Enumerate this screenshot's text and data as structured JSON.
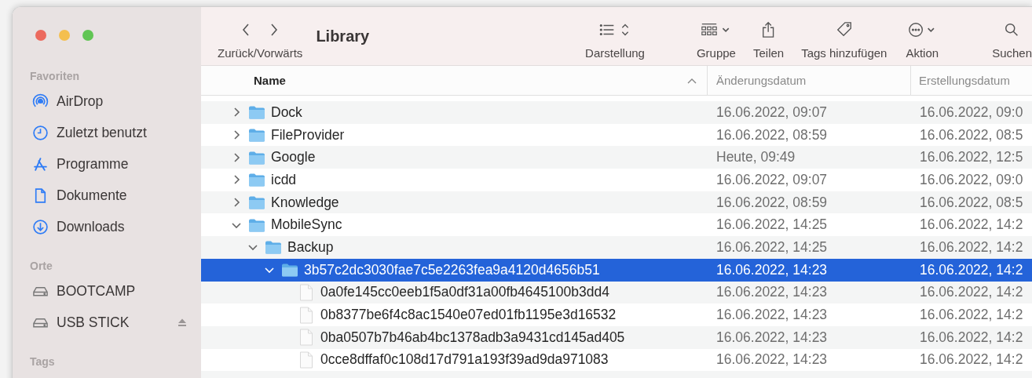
{
  "window": {
    "title": "Library"
  },
  "toolbar": {
    "nav_label": "Zurück/Vorwärts",
    "items": [
      {
        "kind": "view",
        "label": "Darstellung"
      },
      {
        "kind": "group",
        "label": "Gruppe"
      },
      {
        "kind": "share",
        "label": "Teilen"
      },
      {
        "kind": "tags",
        "label": "Tags hinzufügen"
      },
      {
        "kind": "action",
        "label": "Aktion"
      },
      {
        "kind": "search",
        "label": "Suchen"
      }
    ]
  },
  "sidebar": {
    "sections": [
      {
        "title": "Favoriten",
        "items": [
          {
            "kind": "airdrop",
            "label": "AirDrop",
            "selected": false
          },
          {
            "kind": "recent",
            "label": "Zuletzt benutzt",
            "selected": false
          },
          {
            "kind": "apps",
            "label": "Programme",
            "selected": false
          },
          {
            "kind": "documents",
            "label": "Dokumente",
            "selected": false
          },
          {
            "kind": "downloads",
            "label": "Downloads",
            "selected": false
          }
        ]
      },
      {
        "title": "Orte",
        "items": [
          {
            "kind": "drive",
            "label": "BOOTCAMP",
            "selected": false,
            "ejectable": false
          },
          {
            "kind": "drive",
            "label": "USB STICK",
            "selected": false,
            "ejectable": true
          }
        ]
      },
      {
        "title": "Tags"
      }
    ]
  },
  "table": {
    "columns": [
      {
        "label": "Name",
        "sorted": true
      },
      {
        "label": "Änderungsdatum",
        "sorted": false
      },
      {
        "label": "Erstellungsdatum",
        "sorted": false
      }
    ],
    "rows": [
      {
        "kind": "folder",
        "name": "Dock",
        "modified": "16.06.2022, 09:07",
        "created": "16.06.2022, 09:0",
        "expanded": false,
        "selected": false
      },
      {
        "kind": "folder",
        "name": "FileProvider",
        "modified": "16.06.2022, 08:59",
        "created": "16.06.2022, 08:5",
        "expanded": false,
        "selected": false
      },
      {
        "kind": "folder",
        "name": "Google",
        "modified": "Heute, 09:49",
        "created": "16.06.2022, 12:5",
        "expanded": false,
        "selected": false
      },
      {
        "kind": "folder",
        "name": "icdd",
        "modified": "16.06.2022, 09:07",
        "created": "16.06.2022, 09:0",
        "expanded": false,
        "selected": false
      },
      {
        "kind": "folder",
        "name": "Knowledge",
        "modified": "16.06.2022, 08:59",
        "created": "16.06.2022, 08:5",
        "expanded": false,
        "selected": false
      },
      {
        "kind": "folder",
        "name": "MobileSync",
        "modified": "16.06.2022, 14:25",
        "created": "16.06.2022, 14:2",
        "expanded": true,
        "selected": false,
        "children": [
          {
            "kind": "folder",
            "name": "Backup",
            "modified": "16.06.2022, 14:25",
            "created": "16.06.2022, 14:2",
            "expanded": true,
            "selected": false,
            "children": [
              {
                "kind": "folder",
                "name": "3b57c2dc3030fae7c5e2263fea9a4120d4656b51",
                "modified": "16.06.2022, 14:23",
                "created": "16.06.2022, 14:2",
                "expanded": true,
                "selected": true,
                "children": [
                  {
                    "kind": "file",
                    "name": "0a0fe145cc0eeb1f5a0df31a00fb4645100b3dd4",
                    "modified": "16.06.2022, 14:23",
                    "created": "16.06.2022, 14:2",
                    "selected": false
                  },
                  {
                    "kind": "file",
                    "name": "0b8377be6f4c8ac1540e07ed01fb1195e3d16532",
                    "modified": "16.06.2022, 14:23",
                    "created": "16.06.2022, 14:2",
                    "selected": false
                  },
                  {
                    "kind": "file",
                    "name": "0ba0507b7b46ab4bc1378adb3a9431cd145ad405",
                    "modified": "16.06.2022, 14:23",
                    "created": "16.06.2022, 14:2",
                    "selected": false
                  },
                  {
                    "kind": "file",
                    "name": "0cce8dffaf0c108d17d791a193f39ad9da971083",
                    "modified": "16.06.2022, 14:23",
                    "created": "16.06.2022, 14:2",
                    "selected": false
                  }
                ]
              }
            ]
          }
        ]
      }
    ]
  }
}
